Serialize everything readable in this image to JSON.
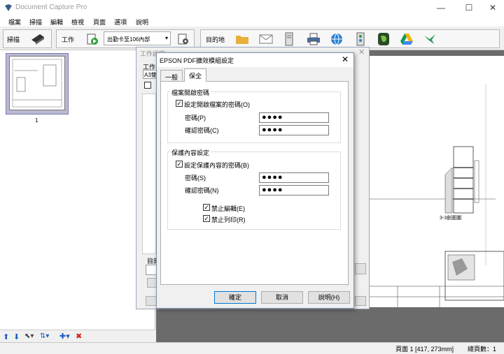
{
  "app": {
    "title": "Document Capture Pro"
  },
  "window_controls": {
    "minimize": "—",
    "maximize": "☐",
    "close": "✕"
  },
  "menu": [
    "檔案",
    "掃描",
    "編輯",
    "檢視",
    "頁面",
    "選項",
    "說明"
  ],
  "toolbar": {
    "scan_label": "掃描",
    "job_label": "工作",
    "job_select": "出勤卡至106內部",
    "destination_label": "目的地"
  },
  "thumbnail": {
    "page_number": "1"
  },
  "status": {
    "page_info": "頁面 1 [417, 273mm]",
    "total_pages": "總頁數：1"
  },
  "back_dialog": {
    "title": "工作設定",
    "fields": [
      "工作",
      "A3雙",
      "目的"
    ]
  },
  "dialog": {
    "title": "EPSON PDF擴效模組設定",
    "close": "✕",
    "tabs": [
      "一般",
      "保全"
    ],
    "active_tab": 1,
    "open_password_group": {
      "title": "檔案開啟密碼",
      "checkbox_label": "設定開啟檔案的密碼(O)",
      "checked": true,
      "password_label": "密碼(P)",
      "password_value": "●●●●",
      "confirm_label": "確認密碼(C)",
      "confirm_value": "●●●●"
    },
    "permission_group": {
      "title": "保護內容設定",
      "checkbox_label": "設定保護內容的密碼(B)",
      "checked": true,
      "password_label": "密碼(S)",
      "password_value": "●●●●",
      "confirm_label": "確認密碼(N)",
      "confirm_value": "●●●●",
      "no_edit_label": "禁止編輯(E)",
      "no_print_label": "禁止列印(R)"
    },
    "buttons": {
      "ok": "確定",
      "cancel": "取消",
      "help": "說明(H)"
    }
  },
  "preview": {
    "drawing_label": "3-3剖面圖"
  },
  "colors": {
    "accent": "#0078d7",
    "preview_bg": "#6b6b6b",
    "selection": "#b9b9d1"
  }
}
